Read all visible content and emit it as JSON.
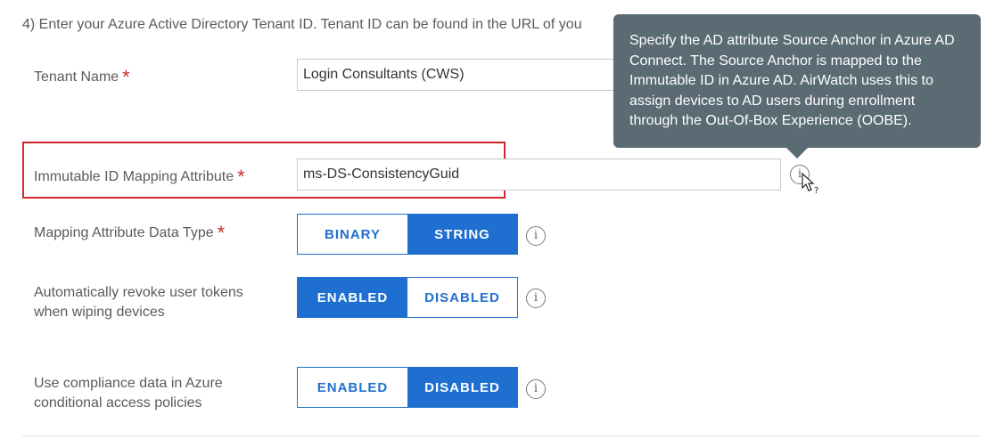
{
  "intro_text": "4) Enter your Azure Active Directory Tenant ID. Tenant ID can be found in the URL of you",
  "tenant_name": {
    "label": "Tenant Name",
    "required": "*",
    "value": "Login Consultants (CWS)"
  },
  "immutable_id": {
    "label": "Immutable ID Mapping Attribute",
    "required": "*",
    "value": "ms-DS-ConsistencyGuid"
  },
  "mapping_type": {
    "label": "Mapping Attribute Data Type",
    "required": "*",
    "options": [
      "BINARY",
      "STRING"
    ],
    "selected": "STRING"
  },
  "revoke_tokens": {
    "label_line1": "Automatically revoke user tokens",
    "label_line2": "when wiping devices",
    "options": [
      "ENABLED",
      "DISABLED"
    ],
    "selected": "ENABLED"
  },
  "compliance": {
    "label_line1": "Use compliance data in Azure",
    "label_line2": "conditional access policies",
    "options": [
      "ENABLED",
      "DISABLED"
    ],
    "selected": "DISABLED"
  },
  "info_glyph": "i",
  "tooltip": {
    "text": "Specify the AD attribute Source Anchor in Azure AD Connect. The Source Anchor is mapped to the Immutable ID in Azure AD. AirWatch uses this to assign devices to AD users during enrollment through the Out-Of-Box Experience (OOBE)."
  },
  "colors": {
    "accent": "#1f6fd1",
    "required": "#c9302c",
    "tooltip_bg": "#5a6b73",
    "highlight": "#d8242b"
  }
}
